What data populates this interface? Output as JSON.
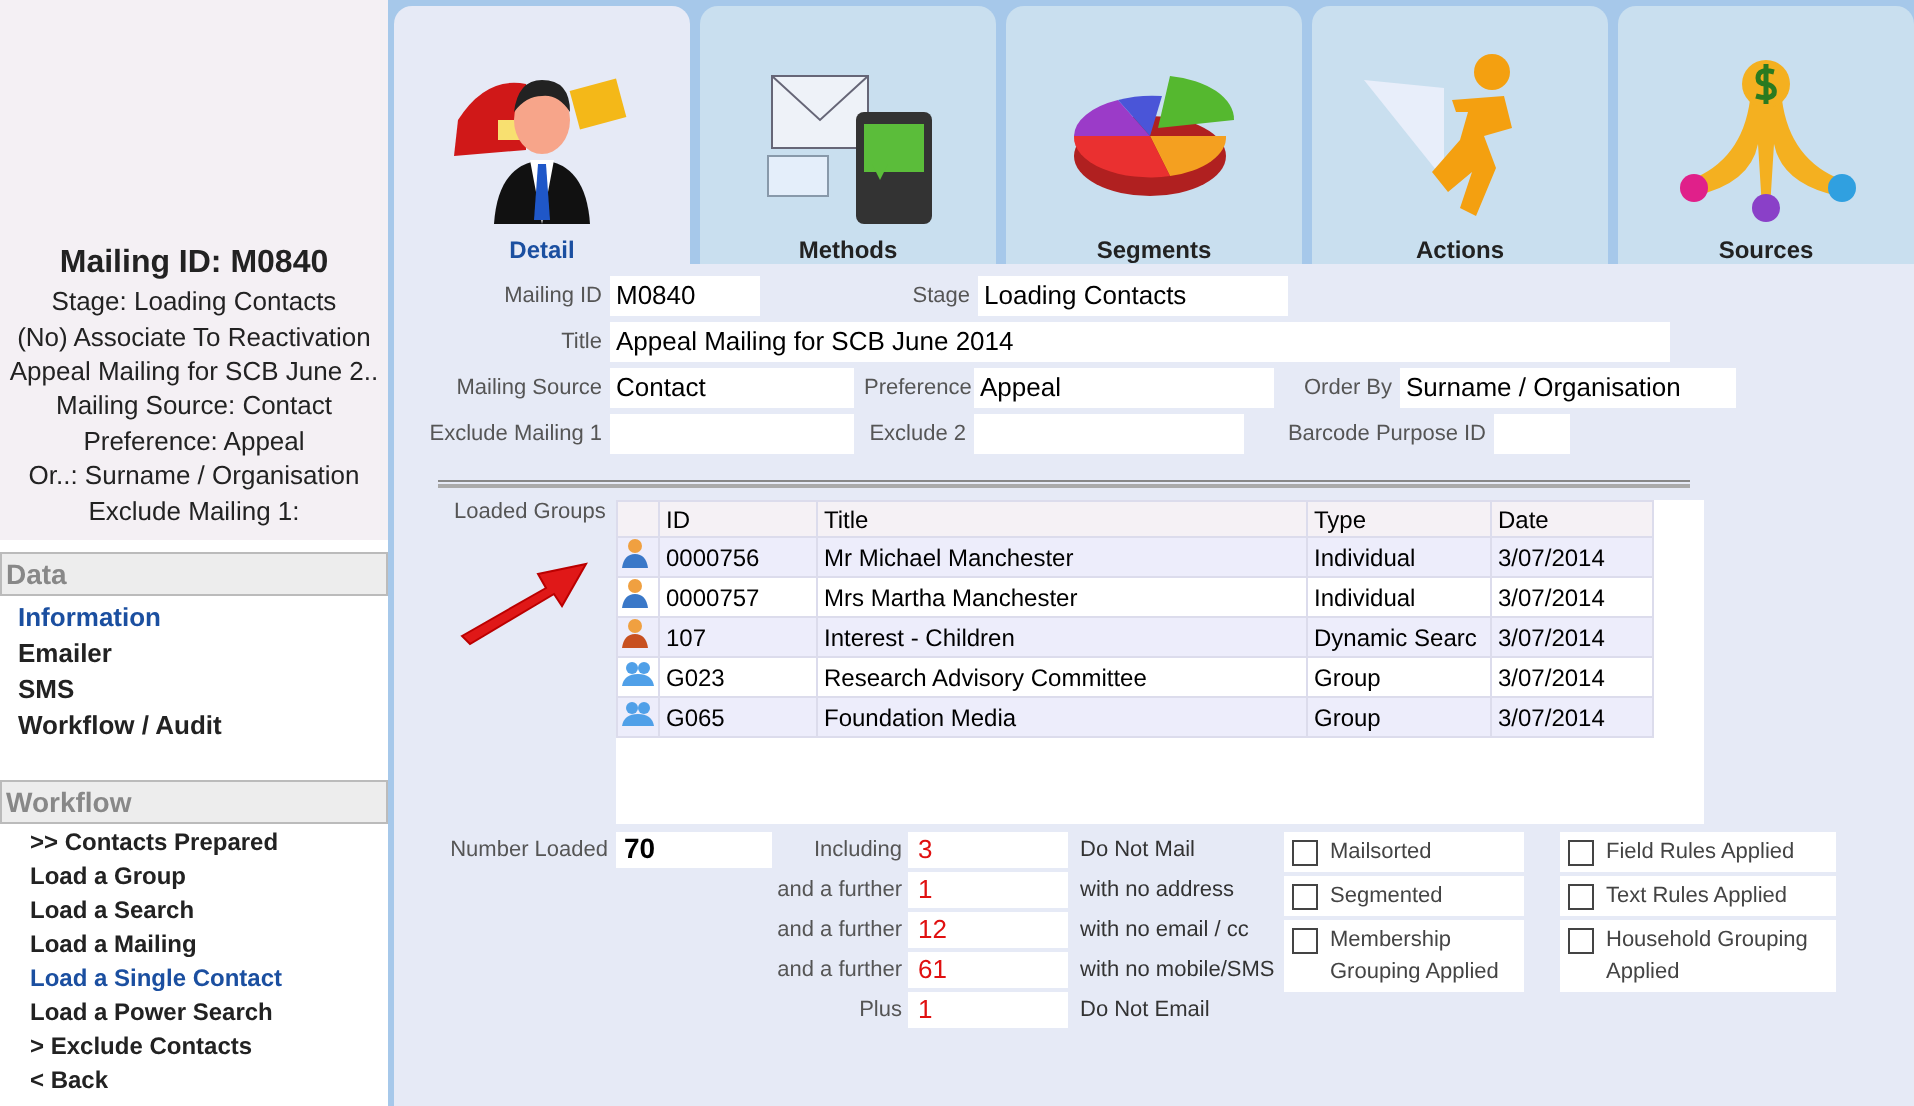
{
  "sidebar": {
    "summary": {
      "title": "Mailing ID: M0840",
      "lines": [
        "Stage: Loading Contacts",
        "(No) Associate To Reactivation",
        "Appeal Mailing for SCB June 2..",
        "Mailing Source: Contact",
        "Preference: Appeal",
        "Or..: Surname / Organisation",
        "Exclude Mailing 1:"
      ]
    },
    "sections": [
      {
        "heading": "Data",
        "kind": "data",
        "items": [
          {
            "label": "Information",
            "selected": true
          },
          {
            "label": "Emailer",
            "selected": false
          },
          {
            "label": "SMS",
            "selected": false
          },
          {
            "label": "Workflow / Audit",
            "selected": false
          }
        ]
      },
      {
        "heading": "Workflow",
        "kind": "workflow",
        "items": [
          {
            "label": ">> Contacts Prepared",
            "selected": false
          },
          {
            "label": "Load a Group",
            "selected": false
          },
          {
            "label": "Load a Search",
            "selected": false
          },
          {
            "label": "Load a Mailing",
            "selected": false
          },
          {
            "label": "Load a Single Contact",
            "selected": true
          },
          {
            "label": "Load a Power Search",
            "selected": false
          },
          {
            "label": "> Exclude Contacts",
            "selected": false
          },
          {
            "label": "< Back",
            "selected": false
          }
        ]
      }
    ]
  },
  "tabs": [
    {
      "label": "Detail",
      "selected": true
    },
    {
      "label": "Methods",
      "selected": false
    },
    {
      "label": "Segments",
      "selected": false
    },
    {
      "label": "Actions",
      "selected": false
    },
    {
      "label": "Sources",
      "selected": false
    }
  ],
  "form": {
    "rows": [
      [
        {
          "label": "Mailing ID",
          "value": "M0840"
        },
        {
          "label": "Stage",
          "value": "Loading Contacts"
        }
      ],
      [
        {
          "label": "Title",
          "value": "Appeal Mailing for SCB June 2014"
        }
      ],
      [
        {
          "label": "Mailing Source",
          "value": "Contact"
        },
        {
          "label": "Preference",
          "value": "Appeal"
        },
        {
          "label": "Order By",
          "value": "Surname / Organisation"
        }
      ],
      [
        {
          "label": "Exclude Mailing 1"
        },
        {
          "label": "Exclude 2"
        },
        {
          "label": "Barcode Purpose ID"
        }
      ]
    ]
  },
  "loaded_groups": {
    "label": "Loaded Groups",
    "columns": [
      "ID",
      "Title",
      "Type",
      "Date"
    ],
    "rows": [
      {
        "kind": "person",
        "cells": [
          "0000756",
          "Mr Michael Manchester",
          "Individual",
          "3/07/2014"
        ]
      },
      {
        "kind": "person",
        "cells": [
          "0000757",
          "Mrs Martha Manchester",
          "Individual",
          "3/07/2014"
        ]
      },
      {
        "kind": "search",
        "cells": [
          "107",
          "Interest - Children",
          "Dynamic Searc",
          "3/07/2014"
        ]
      },
      {
        "kind": "group",
        "cells": [
          "G023",
          "Research Advisory Committee",
          "Group",
          "3/07/2014"
        ]
      },
      {
        "kind": "group",
        "cells": [
          "G065",
          "Foundation Media",
          "Group",
          "3/07/2014"
        ]
      }
    ]
  },
  "number_loaded": {
    "label": "Number Loaded",
    "value": "70"
  },
  "counts": [
    {
      "label": "Including",
      "value": "3",
      "description": "Do Not Mail"
    },
    {
      "label": "and a further",
      "value": "1",
      "description": "with no address"
    },
    {
      "label": "and a further",
      "value": "12",
      "description": "with no email / cc"
    },
    {
      "label": "and a further",
      "value": "61",
      "description": "with no mobile/SMS"
    },
    {
      "label": "Plus",
      "value": "1",
      "description": "Do Not Email"
    }
  ],
  "options": [
    {
      "label": "Mailsorted",
      "checked": false
    },
    {
      "label": "Field Rules Applied",
      "checked": false
    },
    {
      "label": "Segmented",
      "checked": false
    },
    {
      "label": "Text Rules Applied",
      "checked": false
    },
    {
      "label": "Membership Grouping Applied",
      "checked": false
    },
    {
      "label": "Household Grouping Applied",
      "checked": false
    }
  ]
}
